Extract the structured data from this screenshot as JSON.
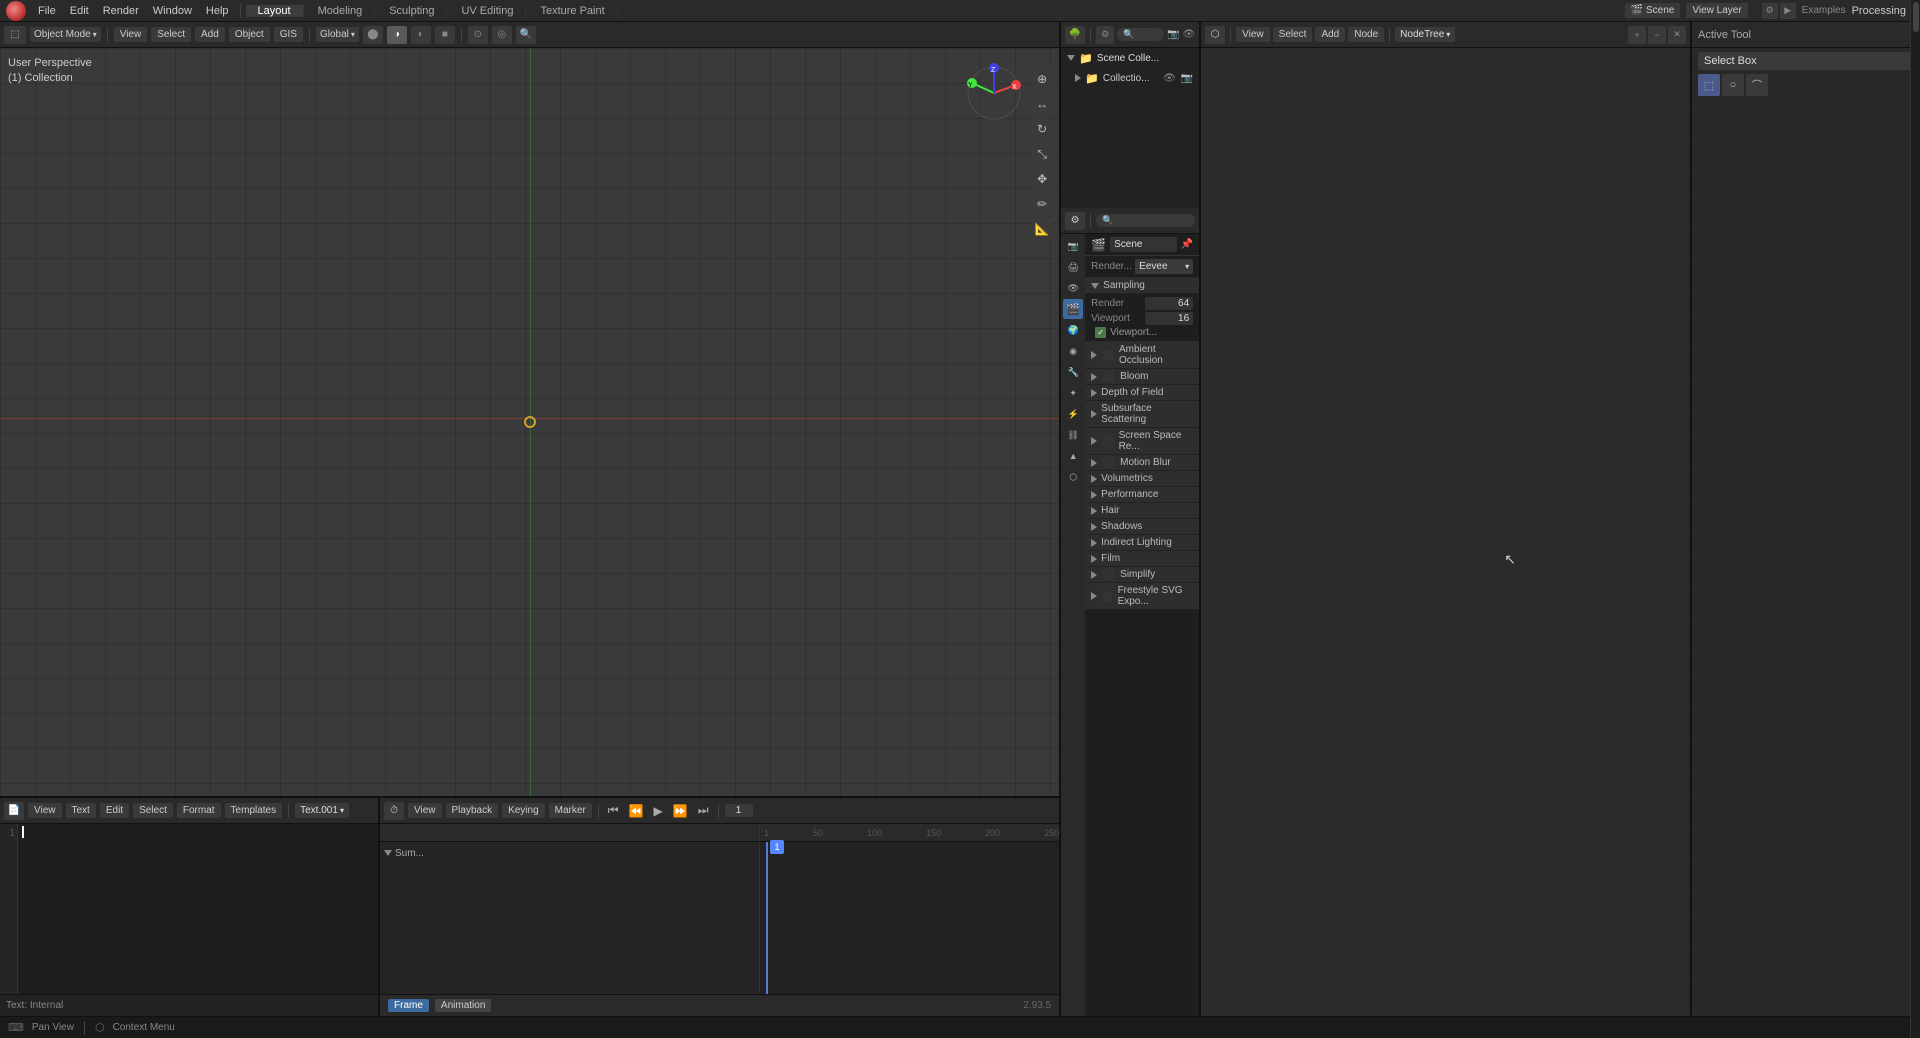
{
  "topbar": {
    "menus": [
      "File",
      "Edit",
      "Render",
      "Window",
      "Help"
    ],
    "workspaces": [
      "Layout",
      "Modeling",
      "Sculpting",
      "UV Editing",
      "Texture Paint"
    ],
    "scene_name": "Scene",
    "view_layer": "View Layer",
    "processing_label": "Processing",
    "examples_label": "Examples"
  },
  "viewport": {
    "mode": "Object Mode",
    "view_label": "View",
    "select_label": "Select",
    "add_label": "Add",
    "object_label": "Object",
    "gis_label": "GIS",
    "perspective_label": "User Perspective",
    "collection_label": "(1) Collection",
    "global_label": "Global",
    "shading_buttons": [
      "✦",
      "◉",
      "◑",
      "■"
    ]
  },
  "outliner": {
    "scene_collections": [
      {
        "name": "Scene Colle...",
        "icon": "📁",
        "type": "scene_collection"
      },
      {
        "name": "Collectio...",
        "icon": "📁",
        "type": "collection",
        "indent": true,
        "eye": true,
        "cam": true
      }
    ]
  },
  "properties": {
    "scene_icon": "🎬",
    "scene_name": "Scene",
    "render_engine_label": "Render...",
    "render_engine_value": "Eevee",
    "sections": [
      {
        "label": "Sampling",
        "expanded": true
      },
      {
        "label": "Ambient Occlusion",
        "expanded": false,
        "checkbox": true
      },
      {
        "label": "Bloom",
        "expanded": false,
        "checkbox": true
      },
      {
        "label": "Depth of Field",
        "expanded": false
      },
      {
        "label": "Subsurface Scattering",
        "expanded": false
      },
      {
        "label": "Screen Space Re...",
        "expanded": false,
        "checkbox": true
      },
      {
        "label": "Motion Blur",
        "expanded": false,
        "checkbox": true
      },
      {
        "label": "Volumetrics",
        "expanded": false
      },
      {
        "label": "Performance",
        "expanded": false
      },
      {
        "label": "Hair",
        "expanded": false
      },
      {
        "label": "Shadows",
        "expanded": false
      },
      {
        "label": "Indirect Lighting",
        "expanded": false
      },
      {
        "label": "Film",
        "expanded": false
      },
      {
        "label": "Simplify",
        "expanded": false,
        "checkbox": true
      },
      {
        "label": "Freestyle SVG Expo...",
        "expanded": false,
        "checkbox": true
      }
    ],
    "sampling_render_label": "Render",
    "sampling_render_val": "64",
    "sampling_viewport_label": "Viewport",
    "sampling_viewport_val": "16",
    "viewport_denoising": "Viewport..."
  },
  "active_tool": {
    "header_label": "Active Tool",
    "tool_name": "Select Box",
    "icons": [
      "⊞",
      "◫",
      "◪"
    ]
  },
  "node_editor": {
    "header_menus": [
      "View",
      "Select",
      "Add",
      "Node"
    ],
    "node_tree_label": "NodeTree"
  },
  "text_editor": {
    "header_items": [
      "Text",
      "Edit",
      "Select",
      "Format",
      "Templates"
    ],
    "current_file": "Text.001",
    "content_lines": [],
    "footer_label": "Text: Internal"
  },
  "timeline": {
    "header_items": [
      "View",
      "Playback",
      "Keying",
      "View",
      "Marker"
    ],
    "ticks": [
      "1",
      "50",
      "100",
      "150",
      "200",
      "250"
    ],
    "track_name": "Sum...",
    "current_frame": "1",
    "footer_tabs": [
      "Frame",
      "Animation"
    ],
    "frame_time": "2.93.5"
  },
  "statusbar": {
    "pan_view": "Pan View",
    "context_menu": "Context Menu"
  }
}
